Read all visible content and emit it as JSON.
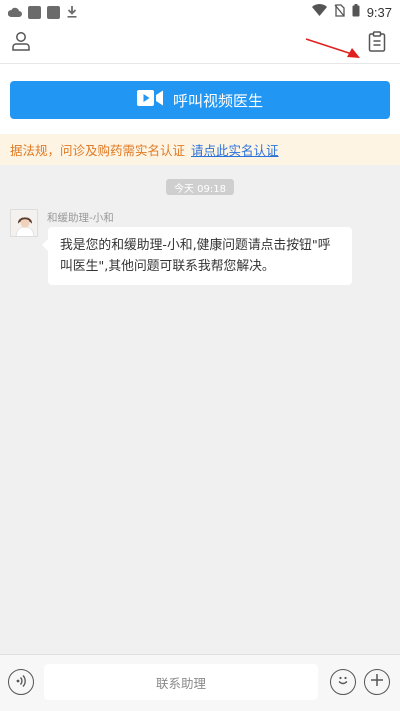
{
  "status_bar": {
    "time": "9:37",
    "icons": [
      "cloud-icon",
      "square-icon",
      "square-icon",
      "download-icon",
      "wifi-icon",
      "no-sim-icon",
      "battery-icon"
    ]
  },
  "header": {
    "icons": [
      "user-profile-icon",
      "clipboard-icon"
    ],
    "annotation": "red-arrow-pointing-to-clipboard"
  },
  "call_button": {
    "label": "呼叫视频医生",
    "icon": "video-camera-icon",
    "color": "#2196f3"
  },
  "notice": {
    "text": "据法规，问诊及购药需实名认证",
    "link": "请点此实名认证",
    "text_color": "#e07a24",
    "link_color": "#2a72d8"
  },
  "chat": {
    "timestamp": "今天 09:18",
    "messages": [
      {
        "sender": "和缓助理-小和",
        "text": "我是您的和缓助理-小和,健康问题请点击按钮\"呼叫医生\",其他问题可联系我帮您解决。"
      }
    ]
  },
  "bottom_bar": {
    "placeholder": "联系助理",
    "icons": [
      "voice-icon",
      "emoji-icon",
      "plus-icon"
    ]
  }
}
